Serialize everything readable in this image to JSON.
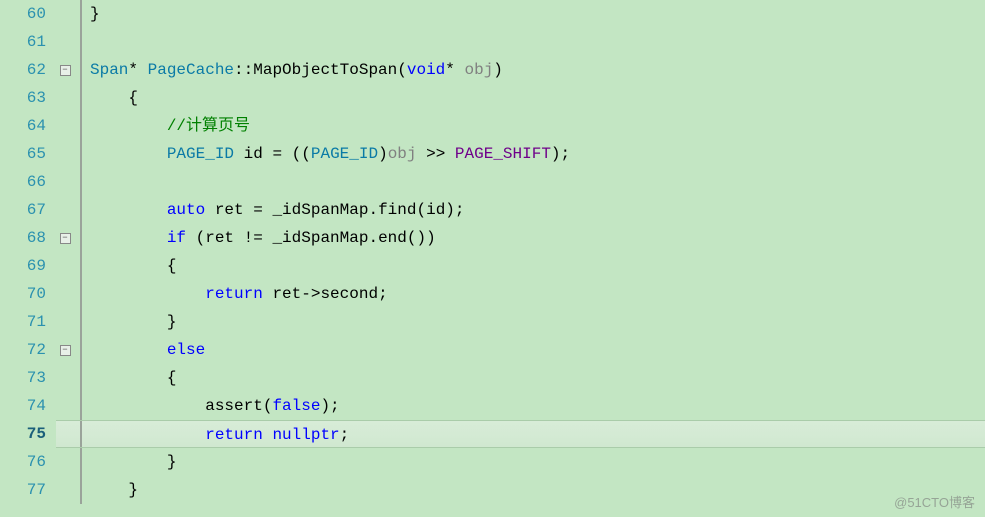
{
  "watermark": "@51CTO博客",
  "current_line": 75,
  "lines": [
    {
      "num": 60,
      "fold": "",
      "tokens": [
        {
          "txt": "}",
          "cls": "c-punct"
        }
      ],
      "indent": 0
    },
    {
      "num": 61,
      "fold": "",
      "tokens": [],
      "indent": 0
    },
    {
      "num": 62,
      "fold": "-",
      "tokens": [
        {
          "txt": "Span",
          "cls": "c-type"
        },
        {
          "txt": "* ",
          "cls": "c-punct"
        },
        {
          "txt": "PageCache",
          "cls": "c-class"
        },
        {
          "txt": "::",
          "cls": "c-punct"
        },
        {
          "txt": "MapObjectToSpan",
          "cls": "c-func"
        },
        {
          "txt": "(",
          "cls": "c-punct"
        },
        {
          "txt": "void",
          "cls": "c-keyword"
        },
        {
          "txt": "* ",
          "cls": "c-punct"
        },
        {
          "txt": "obj",
          "cls": "c-param"
        },
        {
          "txt": ")",
          "cls": "c-punct"
        }
      ],
      "indent": 0
    },
    {
      "num": 63,
      "fold": "",
      "tokens": [
        {
          "txt": "{",
          "cls": "c-punct"
        }
      ],
      "indent": 1
    },
    {
      "num": 64,
      "fold": "",
      "tokens": [
        {
          "txt": "//计算页号",
          "cls": "c-comment"
        }
      ],
      "indent": 2
    },
    {
      "num": 65,
      "fold": "",
      "tokens": [
        {
          "txt": "PAGE_ID",
          "cls": "c-type"
        },
        {
          "txt": " ",
          "cls": ""
        },
        {
          "txt": "id",
          "cls": "c-ident"
        },
        {
          "txt": " = ((",
          "cls": "c-punct"
        },
        {
          "txt": "PAGE_ID",
          "cls": "c-type"
        },
        {
          "txt": ")",
          "cls": "c-punct"
        },
        {
          "txt": "obj",
          "cls": "c-param"
        },
        {
          "txt": " >> ",
          "cls": "c-punct"
        },
        {
          "txt": "PAGE_SHIFT",
          "cls": "c-macro"
        },
        {
          "txt": ");",
          "cls": "c-punct"
        }
      ],
      "indent": 2
    },
    {
      "num": 66,
      "fold": "",
      "tokens": [],
      "indent": 2
    },
    {
      "num": 67,
      "fold": "",
      "tokens": [
        {
          "txt": "auto",
          "cls": "c-keyword"
        },
        {
          "txt": " ",
          "cls": ""
        },
        {
          "txt": "ret",
          "cls": "c-ident"
        },
        {
          "txt": " = ",
          "cls": "c-punct"
        },
        {
          "txt": "_idSpanMap",
          "cls": "c-member"
        },
        {
          "txt": ".",
          "cls": "c-punct"
        },
        {
          "txt": "find",
          "cls": "c-func"
        },
        {
          "txt": "(",
          "cls": "c-punct"
        },
        {
          "txt": "id",
          "cls": "c-ident"
        },
        {
          "txt": ");",
          "cls": "c-punct"
        }
      ],
      "indent": 2
    },
    {
      "num": 68,
      "fold": "-",
      "tokens": [
        {
          "txt": "if",
          "cls": "c-keyword"
        },
        {
          "txt": " (",
          "cls": "c-punct"
        },
        {
          "txt": "ret",
          "cls": "c-ident"
        },
        {
          "txt": " != ",
          "cls": "c-punct"
        },
        {
          "txt": "_idSpanMap",
          "cls": "c-member"
        },
        {
          "txt": ".",
          "cls": "c-punct"
        },
        {
          "txt": "end",
          "cls": "c-func"
        },
        {
          "txt": "())",
          "cls": "c-punct"
        }
      ],
      "indent": 2
    },
    {
      "num": 69,
      "fold": "",
      "tokens": [
        {
          "txt": "{",
          "cls": "c-punct"
        }
      ],
      "indent": 2
    },
    {
      "num": 70,
      "fold": "",
      "tokens": [
        {
          "txt": "return",
          "cls": "c-keyword"
        },
        {
          "txt": " ",
          "cls": ""
        },
        {
          "txt": "ret",
          "cls": "c-ident"
        },
        {
          "txt": "->",
          "cls": "c-punct"
        },
        {
          "txt": "second",
          "cls": "c-member"
        },
        {
          "txt": ";",
          "cls": "c-punct"
        }
      ],
      "indent": 3
    },
    {
      "num": 71,
      "fold": "",
      "tokens": [
        {
          "txt": "}",
          "cls": "c-punct"
        }
      ],
      "indent": 2
    },
    {
      "num": 72,
      "fold": "-",
      "tokens": [
        {
          "txt": "else",
          "cls": "c-keyword"
        }
      ],
      "indent": 2
    },
    {
      "num": 73,
      "fold": "",
      "tokens": [
        {
          "txt": "{",
          "cls": "c-punct"
        }
      ],
      "indent": 2
    },
    {
      "num": 74,
      "fold": "",
      "tokens": [
        {
          "txt": "assert",
          "cls": "c-func"
        },
        {
          "txt": "(",
          "cls": "c-punct"
        },
        {
          "txt": "false",
          "cls": "c-bool"
        },
        {
          "txt": ");",
          "cls": "c-punct"
        }
      ],
      "indent": 3
    },
    {
      "num": 75,
      "fold": "",
      "tokens": [
        {
          "txt": "return",
          "cls": "c-keyword"
        },
        {
          "txt": " ",
          "cls": ""
        },
        {
          "txt": "nullptr",
          "cls": "c-null"
        },
        {
          "txt": ";",
          "cls": "c-punct"
        }
      ],
      "indent": 3
    },
    {
      "num": 76,
      "fold": "",
      "tokens": [
        {
          "txt": "}",
          "cls": "c-punct"
        }
      ],
      "indent": 2
    },
    {
      "num": 77,
      "fold": "",
      "tokens": [
        {
          "txt": "}",
          "cls": "c-punct"
        }
      ],
      "indent": 1
    }
  ]
}
